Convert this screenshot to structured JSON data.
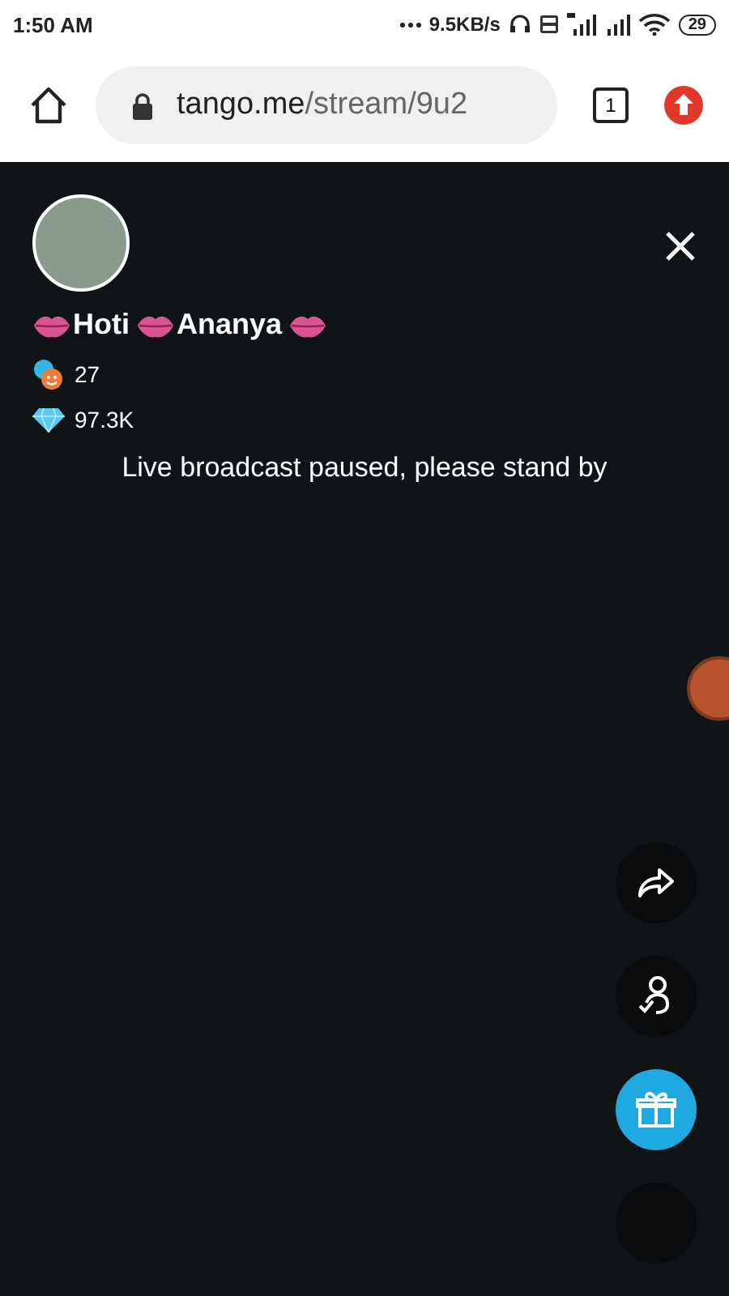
{
  "status_bar": {
    "time": "1:50 AM",
    "speed": "9.5KB/s",
    "battery": "29"
  },
  "browser": {
    "url_host": "tango.me",
    "url_path": "/stream/9u2",
    "tab_count": "1"
  },
  "stream": {
    "name_words": [
      "Hoti",
      "Ananya"
    ],
    "viewers": "27",
    "diamonds": "97.3K",
    "message": "Live broadcast paused, please stand by"
  },
  "actions": [
    {
      "kind": "share"
    },
    {
      "kind": "follow"
    },
    {
      "kind": "gift"
    },
    {
      "kind": "more"
    }
  ]
}
